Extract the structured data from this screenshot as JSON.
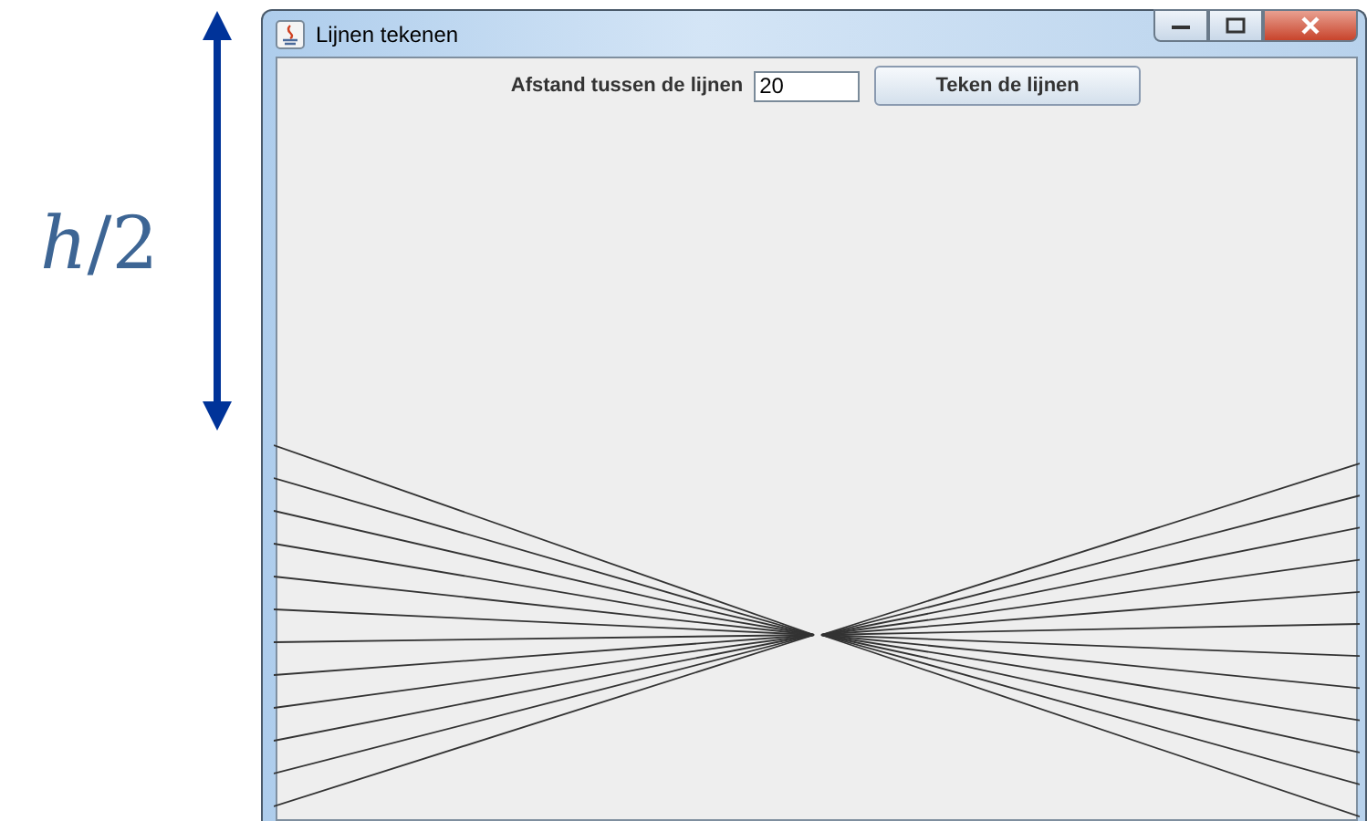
{
  "annotation": {
    "label": "*h*/2"
  },
  "window": {
    "title": "Lijnen tekenen"
  },
  "controls": {
    "label": "Afstand tussen de lijnen",
    "field": {
      "value": "20"
    },
    "button": "Teken de lijnen"
  }
}
